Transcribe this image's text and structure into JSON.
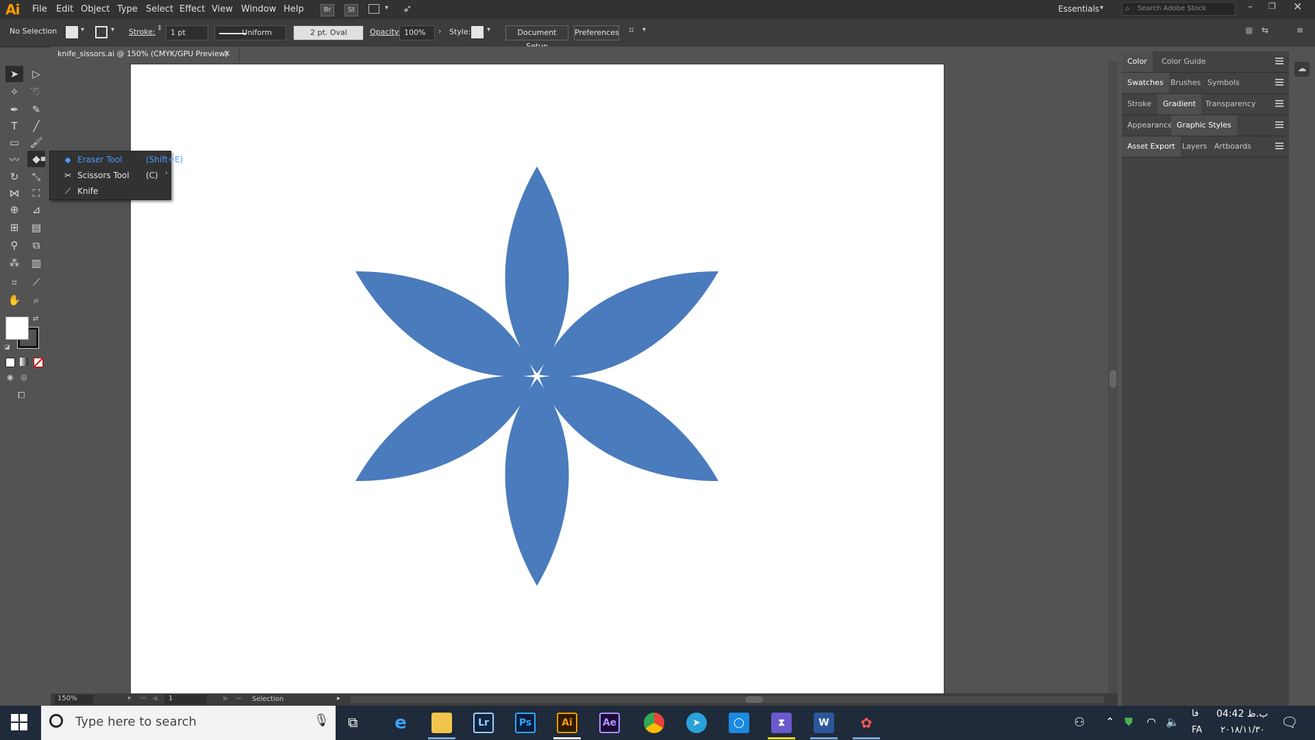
{
  "app": {
    "logo": "Ai",
    "menus": [
      "File",
      "Edit",
      "Object",
      "Type",
      "Select",
      "Effect",
      "View",
      "Window",
      "Help"
    ],
    "bridge_chip": "Br",
    "stock_chip": "St",
    "workspace": "Essentials",
    "stock_search_placeholder": "Search Adobe Stock"
  },
  "control": {
    "selection_state": "No Selection",
    "stroke_label": "Stroke:",
    "stroke_value": "1 pt",
    "profile": "Uniform",
    "brush": "2 pt. Oval",
    "opacity_label": "Opacity:",
    "opacity_value": "100%",
    "style_label": "Style:",
    "document_setup": "Document Setup",
    "preferences": "Preferences"
  },
  "document": {
    "tab_title": "knife_sissors.ai @ 150% (CMYK/GPU Preview)",
    "close_glyph": "×",
    "artwork_color": "#4a7bbd"
  },
  "flyout": {
    "items": [
      {
        "label": "Eraser Tool",
        "shortcut": "(Shift+E)",
        "icon": "eraser-icon",
        "highlight": true
      },
      {
        "label": "Scissors Tool",
        "shortcut": "(C)",
        "icon": "scissors-icon",
        "highlight": false
      },
      {
        "label": "Knife",
        "shortcut": "",
        "icon": "knife-icon",
        "highlight": false
      }
    ]
  },
  "panels": {
    "row1": [
      "Color",
      "Color Guide"
    ],
    "row2": [
      "Swatches",
      "Brushes",
      "Symbols"
    ],
    "row3": [
      "Stroke",
      "Gradient",
      "Transparency"
    ],
    "row4": [
      "Appearance",
      "Graphic Styles"
    ],
    "row5": [
      "Asset Export",
      "Layers",
      "Artboards"
    ]
  },
  "status": {
    "zoom": "150%",
    "artboard_num": "1",
    "tool_name": "Selection"
  },
  "taskbar": {
    "search_placeholder": "Type here to search",
    "apps": [
      "Lr",
      "Ps",
      "Ai",
      "Ae",
      "W"
    ],
    "lang": "FA",
    "time": "04:42 ب.ظ",
    "date": "۲۰۱۸/۱۱/۳۰",
    "lang_indicator": "فا"
  }
}
